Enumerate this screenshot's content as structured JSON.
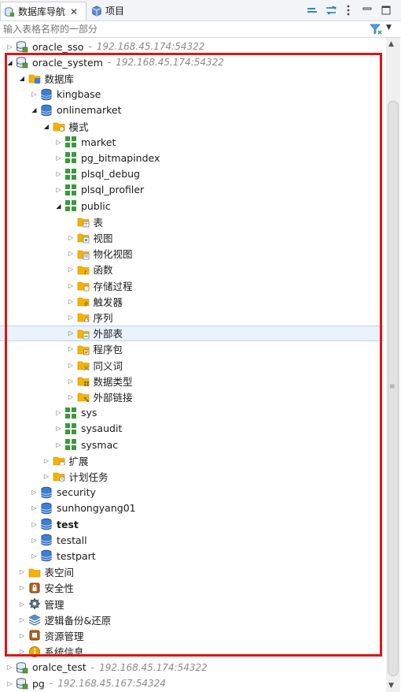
{
  "tabs": [
    {
      "label": "数据库导航",
      "icon": "database-navigator-icon",
      "close": "✕"
    },
    {
      "label": "项目",
      "icon": "project-cube-icon"
    }
  ],
  "toolbar": {
    "collapse_icon": "collapse-all-icon",
    "link_icon": "link-with-editor-icon",
    "menu_icon": "view-menu-icon",
    "minimize_icon": "minimize-icon",
    "maximize_icon": "maximize-icon"
  },
  "filter": {
    "placeholder": "输入表格名称的一部分",
    "icon": "filter-funnel-icon"
  },
  "tree": [
    {
      "indent": 0,
      "tw": "collapsed",
      "icon": "db-connection",
      "label": "oracle_sso",
      "addr": "192.168.45.174:54322"
    },
    {
      "indent": 0,
      "tw": "expanded",
      "icon": "db-connection",
      "label": "oracle_system",
      "addr": "192.168.45.174:54322"
    },
    {
      "indent": 1,
      "tw": "expanded",
      "icon": "folder-db",
      "label": "数据库"
    },
    {
      "indent": 2,
      "tw": "collapsed",
      "icon": "database",
      "label": "kingbase"
    },
    {
      "indent": 2,
      "tw": "expanded",
      "icon": "database",
      "label": "onlinemarket"
    },
    {
      "indent": 3,
      "tw": "expanded",
      "icon": "folder-schema",
      "label": "模式"
    },
    {
      "indent": 4,
      "tw": "collapsed",
      "icon": "schema",
      "label": "market"
    },
    {
      "indent": 4,
      "tw": "collapsed",
      "icon": "schema",
      "label": "pg_bitmapindex"
    },
    {
      "indent": 4,
      "tw": "collapsed",
      "icon": "schema",
      "label": "plsql_debug"
    },
    {
      "indent": 4,
      "tw": "collapsed",
      "icon": "schema",
      "label": "plsql_profiler"
    },
    {
      "indent": 4,
      "tw": "expanded",
      "icon": "schema",
      "label": "public"
    },
    {
      "indent": 5,
      "tw": "none",
      "icon": "folder-table",
      "label": "表"
    },
    {
      "indent": 5,
      "tw": "collapsed",
      "icon": "folder-view",
      "label": "视图"
    },
    {
      "indent": 5,
      "tw": "collapsed",
      "icon": "folder-mview",
      "label": "物化视图"
    },
    {
      "indent": 5,
      "tw": "collapsed",
      "icon": "folder-func",
      "label": "函数"
    },
    {
      "indent": 5,
      "tw": "collapsed",
      "icon": "folder-proc",
      "label": "存储过程"
    },
    {
      "indent": 5,
      "tw": "collapsed",
      "icon": "folder-trigger",
      "label": "触发器"
    },
    {
      "indent": 5,
      "tw": "collapsed",
      "icon": "folder-seq",
      "label": "序列"
    },
    {
      "indent": 5,
      "tw": "collapsed",
      "icon": "folder-ext",
      "label": "外部表",
      "selected": true
    },
    {
      "indent": 5,
      "tw": "collapsed",
      "icon": "folder-pkg",
      "label": "程序包"
    },
    {
      "indent": 5,
      "tw": "collapsed",
      "icon": "folder-syn",
      "label": "同义词"
    },
    {
      "indent": 5,
      "tw": "collapsed",
      "icon": "folder-type",
      "label": "数据类型"
    },
    {
      "indent": 5,
      "tw": "collapsed",
      "icon": "folder-link",
      "label": "外部链接"
    },
    {
      "indent": 4,
      "tw": "collapsed",
      "icon": "schema",
      "label": "sys"
    },
    {
      "indent": 4,
      "tw": "collapsed",
      "icon": "schema",
      "label": "sysaudit"
    },
    {
      "indent": 4,
      "tw": "collapsed",
      "icon": "schema",
      "label": "sysmac"
    },
    {
      "indent": 3,
      "tw": "collapsed",
      "icon": "folder-ext2",
      "label": "扩展"
    },
    {
      "indent": 3,
      "tw": "collapsed",
      "icon": "folder-sched",
      "label": "计划任务"
    },
    {
      "indent": 2,
      "tw": "collapsed",
      "icon": "database",
      "label": "security"
    },
    {
      "indent": 2,
      "tw": "collapsed",
      "icon": "database",
      "label": "sunhongyang01"
    },
    {
      "indent": 2,
      "tw": "collapsed",
      "icon": "database",
      "label": "test",
      "bold": true
    },
    {
      "indent": 2,
      "tw": "collapsed",
      "icon": "database",
      "label": "testall"
    },
    {
      "indent": 2,
      "tw": "collapsed",
      "icon": "database",
      "label": "testpart"
    },
    {
      "indent": 1,
      "tw": "collapsed",
      "icon": "folder-plain",
      "label": "表空间"
    },
    {
      "indent": 1,
      "tw": "collapsed",
      "icon": "security",
      "label": "安全性"
    },
    {
      "indent": 1,
      "tw": "collapsed",
      "icon": "gear",
      "label": "管理"
    },
    {
      "indent": 1,
      "tw": "collapsed",
      "icon": "layers",
      "label": "逻辑备份&还原"
    },
    {
      "indent": 1,
      "tw": "collapsed",
      "icon": "resource",
      "label": "资源管理"
    },
    {
      "indent": 1,
      "tw": "collapsed",
      "icon": "info",
      "label": "系统信息"
    },
    {
      "indent": 0,
      "tw": "collapsed",
      "icon": "db-connection",
      "label": "oralce_test",
      "addr": "192.168.45.174:54322"
    },
    {
      "indent": 0,
      "tw": "collapsed",
      "icon": "db-connection",
      "label": "pg",
      "addr": "192.168.45.167:54324"
    }
  ],
  "colors": {
    "highlight_box": "#e01414",
    "selection": "#eaf2fb",
    "folder": "#f5b301",
    "schema": "#3a9a3a",
    "db": "#2f6fc0"
  }
}
